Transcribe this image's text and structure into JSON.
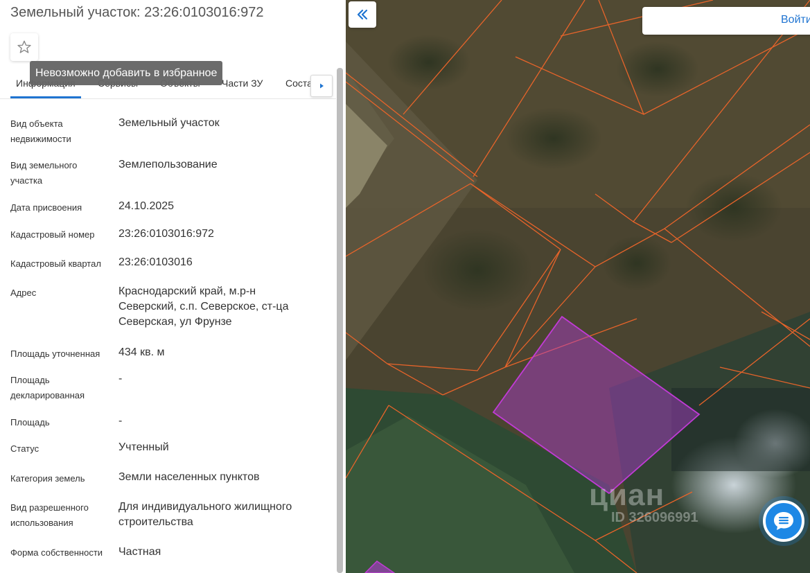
{
  "panel": {
    "title": "Земельный участок: 23:26:0103016:972",
    "tooltip": "Невозможно добавить в избранное",
    "favorite_icon": "star-icon",
    "tabs": [
      {
        "label": "Информация",
        "active": true
      },
      {
        "label": "Сервисы"
      },
      {
        "label": "Объекты"
      },
      {
        "label": "Части ЗУ"
      },
      {
        "label": "Соста..."
      }
    ],
    "rows": [
      {
        "label": "Вид объекта недвижимости",
        "value": "Земельный участок"
      },
      {
        "label": "Вид земельного участка",
        "value": "Землепользование"
      },
      {
        "label": "Дата присвоения",
        "value": "24.10.2025"
      },
      {
        "label": "Кадастровый номер",
        "value": "23:26:0103016:972"
      },
      {
        "label": "Кадастровый квартал",
        "value": "23:26:0103016"
      },
      {
        "label": "Адрес",
        "value": "Краснодарский край, м.р-н Северский, с.п. Северское, ст-ца Северская, ул Фрунзе"
      },
      {
        "label": "Площадь уточненная",
        "value": "434 кв. м"
      },
      {
        "label": "Площадь декларированная",
        "value": "-"
      },
      {
        "label": "Площадь",
        "value": "-"
      },
      {
        "label": "Статус",
        "value": "Учтенный"
      },
      {
        "label": "Категория земель",
        "value": "Земли населенных пунктов"
      },
      {
        "label": "Вид разрешенного использования",
        "value": "Для индивидуального жилищного строительства"
      },
      {
        "label": "Форма собственности",
        "value": "Частная"
      }
    ]
  },
  "map": {
    "login_label": "Войти",
    "watermark_logo": "циан",
    "watermark_id": "ID 326096991",
    "colors": {
      "boundary": "#e8642a",
      "selected": "#c13bd6",
      "accent": "#1f74d1",
      "chat": "#1e88e5"
    }
  }
}
